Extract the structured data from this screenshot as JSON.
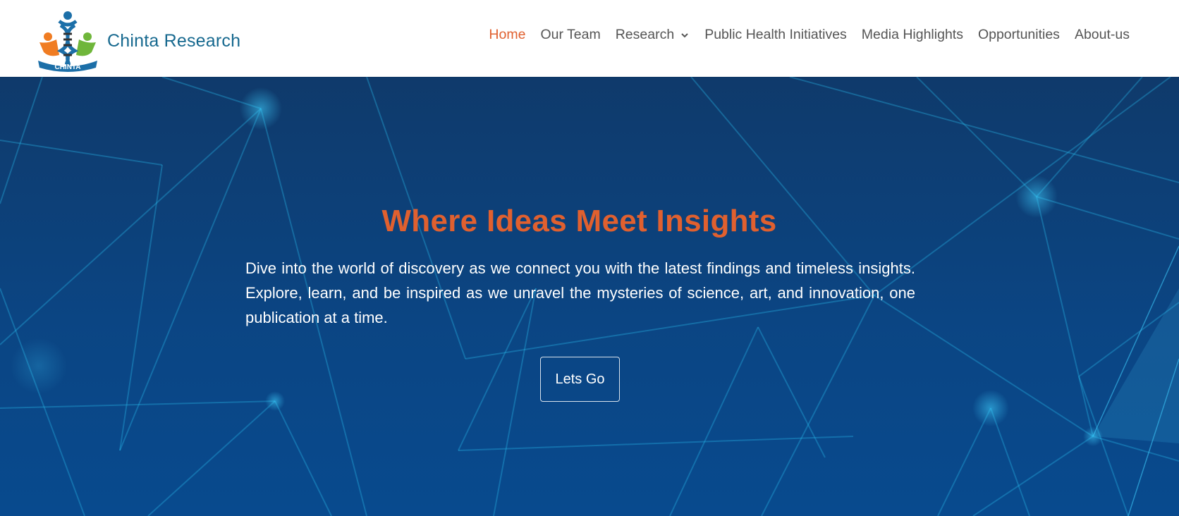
{
  "site": {
    "brand_name": "Chinta Research",
    "logo_text": "CHINTA",
    "logo_icon": "dna-people-logo"
  },
  "nav": {
    "items": [
      {
        "label": "Home",
        "active": true
      },
      {
        "label": "Our Team"
      },
      {
        "label": "Research",
        "has_dropdown": true,
        "icon": "chevron-down-icon"
      },
      {
        "label": "Public Health Initiatives"
      },
      {
        "label": "Media Highlights"
      },
      {
        "label": "Opportunities"
      },
      {
        "label": "About-us"
      }
    ]
  },
  "hero": {
    "title": "Where Ideas Meet Insights",
    "text": "Dive into the world of discovery as we connect you with the latest findings and timeless insights. Explore, learn, and be inspired as we unravel the mysteries of science, art, and innovation, one publication at a time.",
    "button_label": "Lets Go",
    "background": "network-lines-pattern"
  },
  "colors": {
    "accent": "#e0602f",
    "brand": "#17698f",
    "nav_text": "#555555",
    "hero_bg": "#0b4583",
    "line": "#29b6e8"
  }
}
